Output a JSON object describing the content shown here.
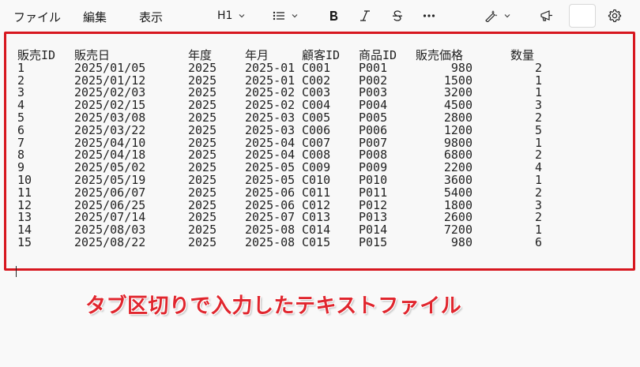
{
  "menu": {
    "file": "ファイル",
    "edit": "編集",
    "view": "表示"
  },
  "toolbar": {
    "heading": "H1",
    "icons": [
      "list-icon",
      "bold-icon",
      "italic-icon",
      "strikethrough-icon",
      "more-icon",
      "rewrite-icon",
      "megaphone-icon",
      "gear-icon"
    ]
  },
  "document": {
    "headers": [
      "販売ID",
      "販売日",
      "年度",
      "年月",
      "顧客ID",
      "商品ID",
      "販売価格",
      "数量"
    ],
    "rows": [
      [
        "1",
        "2025/01/05",
        "2025",
        "2025-01",
        "C001",
        "P001",
        "980",
        "2"
      ],
      [
        "2",
        "2025/01/12",
        "2025",
        "2025-01",
        "C002",
        "P002",
        "1500",
        "1"
      ],
      [
        "3",
        "2025/02/03",
        "2025",
        "2025-02",
        "C003",
        "P003",
        "3200",
        "1"
      ],
      [
        "4",
        "2025/02/15",
        "2025",
        "2025-02",
        "C004",
        "P004",
        "4500",
        "3"
      ],
      [
        "5",
        "2025/03/08",
        "2025",
        "2025-03",
        "C005",
        "P005",
        "2800",
        "2"
      ],
      [
        "6",
        "2025/03/22",
        "2025",
        "2025-03",
        "C006",
        "P006",
        "1200",
        "5"
      ],
      [
        "7",
        "2025/04/10",
        "2025",
        "2025-04",
        "C007",
        "P007",
        "9800",
        "1"
      ],
      [
        "8",
        "2025/04/18",
        "2025",
        "2025-04",
        "C008",
        "P008",
        "6800",
        "2"
      ],
      [
        "9",
        "2025/05/02",
        "2025",
        "2025-05",
        "C009",
        "P009",
        "2200",
        "4"
      ],
      [
        "10",
        "2025/05/19",
        "2025",
        "2025-05",
        "C010",
        "P010",
        "3600",
        "1"
      ],
      [
        "11",
        "2025/06/07",
        "2025",
        "2025-06",
        "C011",
        "P011",
        "5400",
        "2"
      ],
      [
        "12",
        "2025/06/25",
        "2025",
        "2025-06",
        "C012",
        "P012",
        "1800",
        "3"
      ],
      [
        "13",
        "2025/07/14",
        "2025",
        "2025-07",
        "C013",
        "P013",
        "2600",
        "2"
      ],
      [
        "14",
        "2025/08/03",
        "2025",
        "2025-08",
        "C014",
        "P014",
        "7200",
        "1"
      ],
      [
        "15",
        "2025/08/22",
        "2025",
        "2025-08",
        "C015",
        "P015",
        "980",
        "6"
      ]
    ]
  },
  "caption": "タブ区切りで入力したテキストファイル",
  "colors": {
    "highlight_border": "#d7171f",
    "caption_text": "#e0262e"
  }
}
